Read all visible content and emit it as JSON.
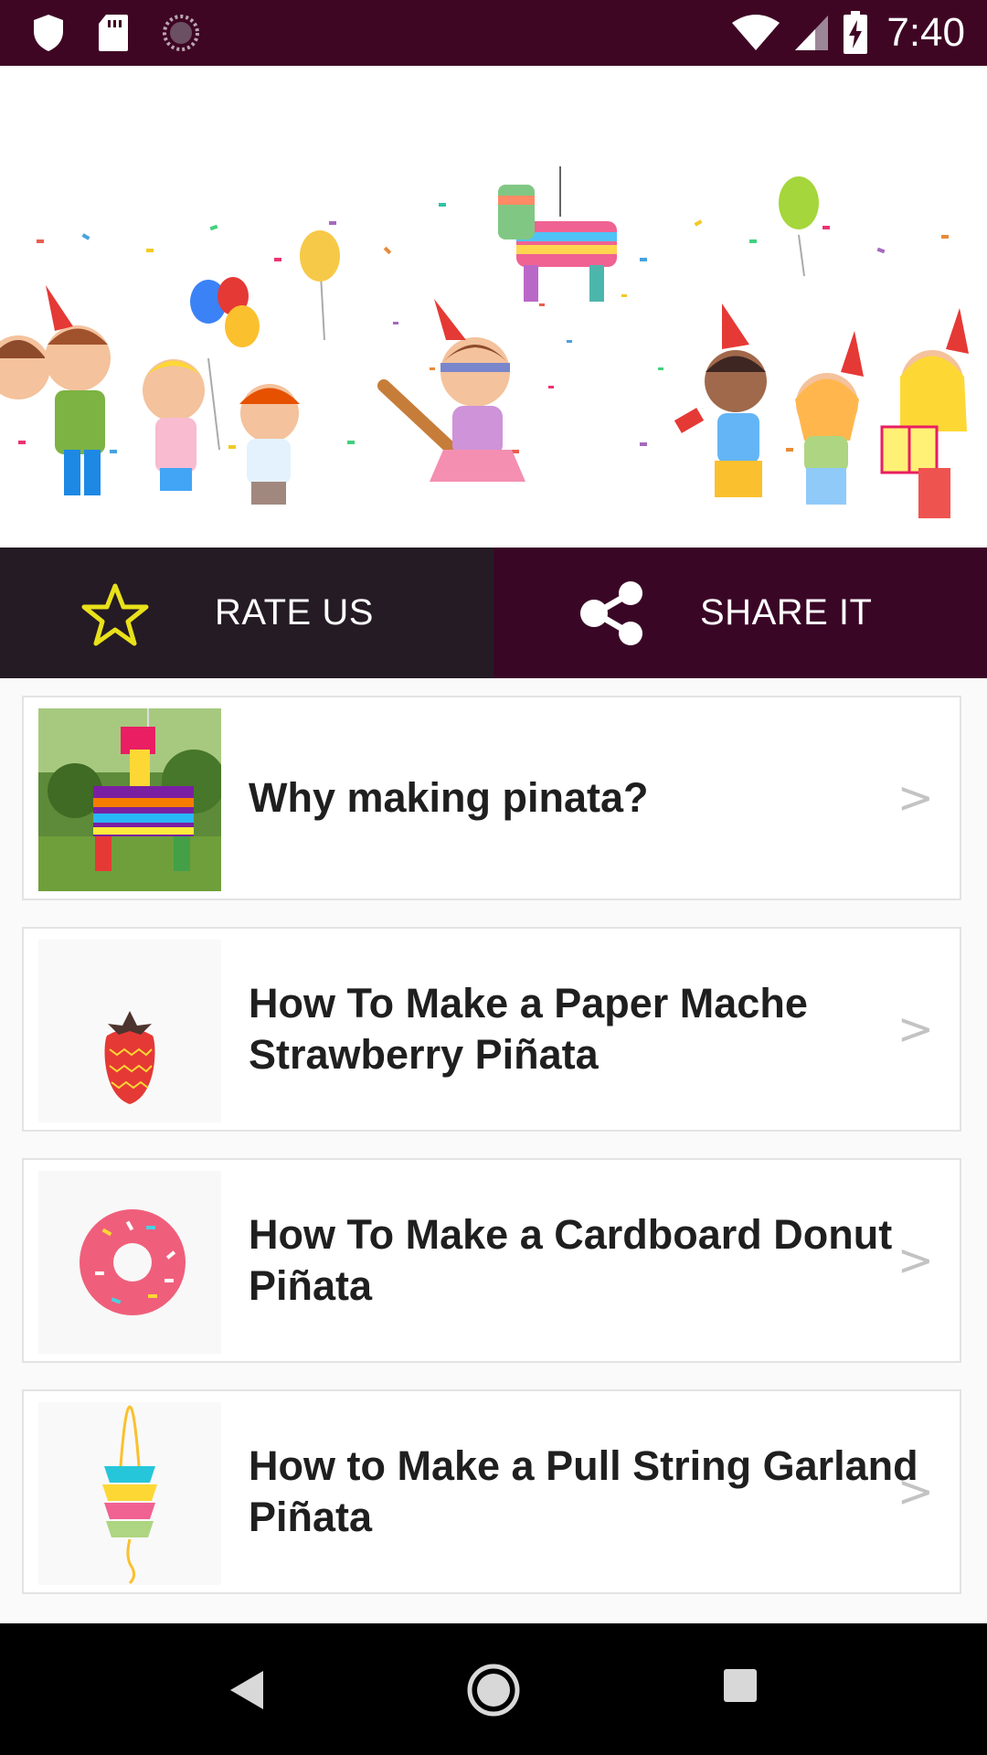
{
  "status_bar": {
    "time": "7:40",
    "left_icons": [
      "shield-icon",
      "sd-card-icon",
      "loading-circle-icon"
    ],
    "right_icons": [
      "wifi-icon",
      "cell-signal-icon",
      "battery-charging-icon"
    ]
  },
  "banner": {
    "image": "party-children-pinata-illustration"
  },
  "actions": {
    "rate_label": "RATE US",
    "share_label": "SHARE IT",
    "colors": {
      "rate_bg": "#251b24",
      "share_bg": "#3a0626",
      "star": "#e9e11a"
    }
  },
  "list": {
    "items": [
      {
        "title": "Why making pinata?",
        "thumbnail": "donkey-pinata-photo"
      },
      {
        "title": "How To Make a Paper Mache Strawberry Piñata",
        "thumbnail": "strawberry-icon"
      },
      {
        "title": "How To Make a Cardboard Donut Piñata",
        "thumbnail": "donut-icon"
      },
      {
        "title": "How to Make a Pull String Garland Piñata",
        "thumbnail": "garland-pinata-icon"
      }
    ],
    "chevron": ">"
  },
  "nav_bar": {
    "buttons": [
      "back-icon",
      "home-icon",
      "recents-icon"
    ]
  }
}
